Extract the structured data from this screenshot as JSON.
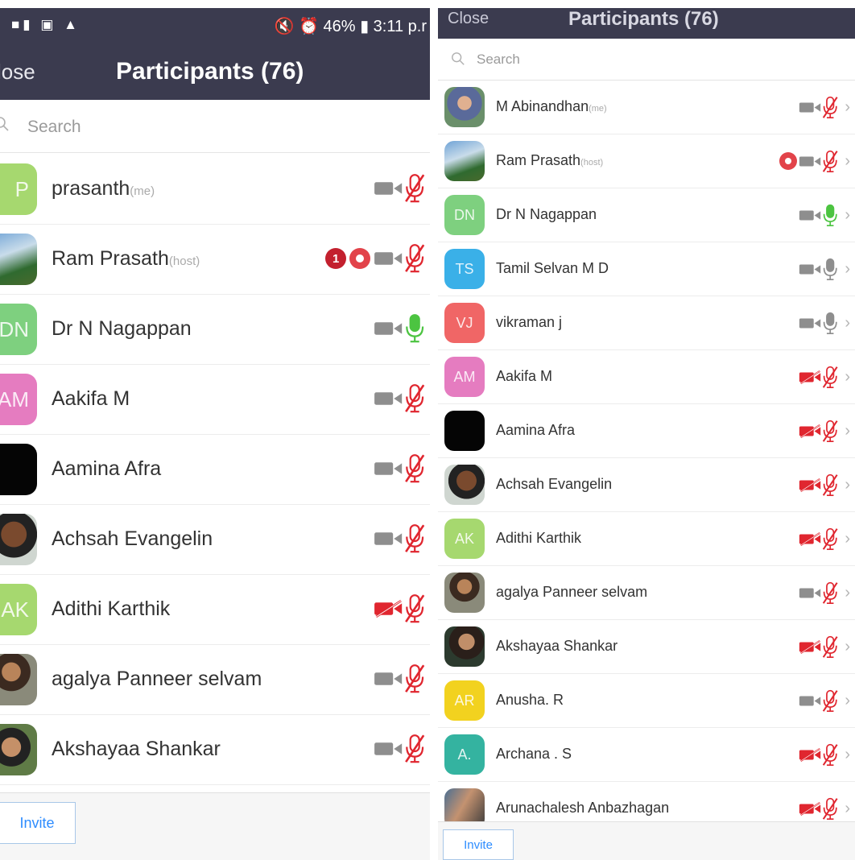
{
  "left": {
    "status_bar": {
      "left_icons": "■▮ ▣ ▲",
      "right_text": "🔇 ⏰ 46% ▮ 3:11 p.r"
    },
    "close_label": "lose",
    "title": "Participants (76)",
    "search_placeholder": "Search",
    "invite_label": "Invite",
    "participants": [
      {
        "initials": "P",
        "avatar_color": "#a6d86f",
        "name": "prasanth",
        "tag": "(me)",
        "video": "on",
        "audio": "muted"
      },
      {
        "initials": "",
        "avatar_photo": "photo-a",
        "name": "Ram Prasath",
        "tag": "(host)",
        "badge": "1",
        "recording": true,
        "video": "on",
        "audio": "muted"
      },
      {
        "initials": "DN",
        "avatar_color": "#7ed07f",
        "name": "Dr N Nagappan",
        "tag": "",
        "video": "on",
        "audio": "active"
      },
      {
        "initials": "AM",
        "avatar_color": "#e57cc0",
        "name": "Aakifa M",
        "tag": "",
        "video": "on",
        "audio": "muted"
      },
      {
        "initials": "",
        "avatar_color": "#050505",
        "name": "Aamina Afra",
        "tag": "",
        "video": "on",
        "audio": "muted"
      },
      {
        "initials": "",
        "avatar_photo": "photo-b",
        "name": "Achsah Evangelin",
        "tag": "",
        "video": "on",
        "audio": "muted"
      },
      {
        "initials": "AK",
        "avatar_color": "#a6d86f",
        "name": "Adithi Karthik",
        "tag": "",
        "video": "off",
        "audio": "muted"
      },
      {
        "initials": "",
        "avatar_photo": "photo-c",
        "name": "agalya Panneer selvam",
        "tag": "",
        "video": "on",
        "audio": "muted"
      },
      {
        "initials": "",
        "avatar_photo": "photo-d",
        "name": "Akshayaa Shankar",
        "tag": "",
        "video": "on",
        "audio": "muted"
      }
    ]
  },
  "right": {
    "close_label": "Close",
    "title": "Participants (76)",
    "search_placeholder": "Search",
    "invite_label": "Invite",
    "participants": [
      {
        "initials": "",
        "avatar_photo": "photo-g",
        "name": "M Abinandhan",
        "tag": "(me)",
        "video": "on",
        "audio": "muted"
      },
      {
        "initials": "",
        "avatar_photo": "photo-a",
        "name": "Ram Prasath",
        "tag": "(host)",
        "recording": true,
        "video": "on",
        "audio": "muted"
      },
      {
        "initials": "DN",
        "avatar_color": "#7ed07f",
        "name": "Dr N Nagappan",
        "tag": "",
        "video": "on",
        "audio": "active"
      },
      {
        "initials": "TS",
        "avatar_color": "#3ab0e8",
        "name": "Tamil Selvan M D",
        "tag": "",
        "video": "on",
        "audio": "idle"
      },
      {
        "initials": "VJ",
        "avatar_color": "#f06666",
        "name": "vikraman j",
        "tag": "",
        "video": "on",
        "audio": "idle"
      },
      {
        "initials": "AM",
        "avatar_color": "#e57cc0",
        "name": "Aakifa M",
        "tag": "",
        "video": "off",
        "audio": "muted"
      },
      {
        "initials": "",
        "avatar_color": "#050505",
        "name": "Aamina Afra",
        "tag": "",
        "video": "off",
        "audio": "muted"
      },
      {
        "initials": "",
        "avatar_photo": "photo-b",
        "name": "Achsah Evangelin",
        "tag": "",
        "video": "off",
        "audio": "muted"
      },
      {
        "initials": "AK",
        "avatar_color": "#a6d86f",
        "name": "Adithi Karthik",
        "tag": "",
        "video": "off",
        "audio": "muted"
      },
      {
        "initials": "",
        "avatar_photo": "photo-c",
        "name": "agalya Panneer selvam",
        "tag": "",
        "video": "on",
        "audio": "muted"
      },
      {
        "initials": "",
        "avatar_photo": "photo-e",
        "name": "Akshayaa Shankar",
        "tag": "",
        "video": "off",
        "audio": "muted"
      },
      {
        "initials": "AR",
        "avatar_color": "#f2d21f",
        "name": "Anusha. R",
        "tag": "",
        "video": "on",
        "audio": "muted"
      },
      {
        "initials": "A.",
        "avatar_color": "#34b3a0",
        "name": "Archana . S",
        "tag": "",
        "video": "off",
        "audio": "muted"
      },
      {
        "initials": "",
        "avatar_photo": "photo-f",
        "name": "Arunachalesh Anbazhagan",
        "tag": "",
        "video": "off",
        "audio": "muted"
      }
    ]
  },
  "colors": {
    "header_bg": "#3b3b4f",
    "muted_red": "#e0262f",
    "active_green": "#4cc441",
    "icon_gray": "#8e8e8e",
    "link_blue": "#2d8cff"
  }
}
